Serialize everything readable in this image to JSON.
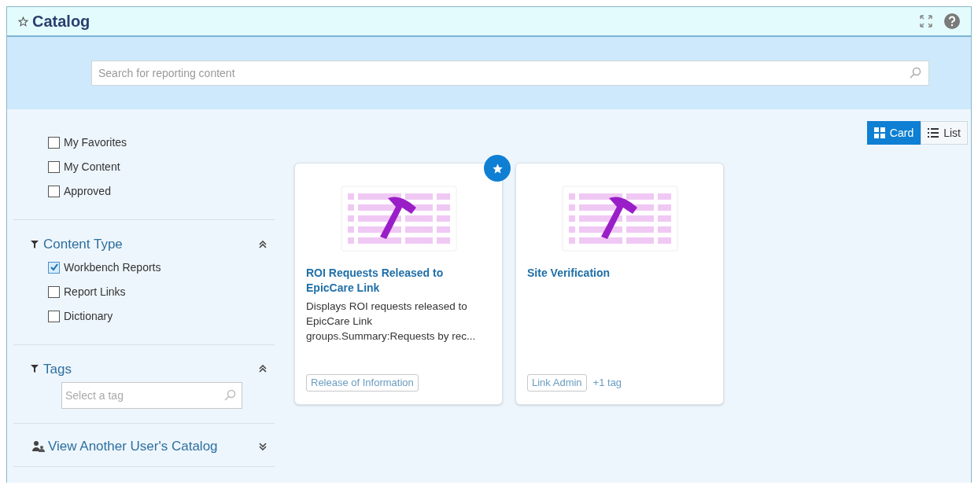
{
  "window": {
    "title": "Catalog"
  },
  "search": {
    "placeholder": "Search for reporting content"
  },
  "view_toggle": [
    {
      "label": "Card",
      "selected": true
    },
    {
      "label": "List",
      "selected": false
    }
  ],
  "quick_filters": [
    {
      "label": "My Favorites",
      "checked": false
    },
    {
      "label": "My Content",
      "checked": false
    },
    {
      "label": "Approved",
      "checked": false
    }
  ],
  "content_type": {
    "title": "Content Type",
    "expanded": true,
    "options": [
      {
        "label": "Workbench Reports",
        "checked": true
      },
      {
        "label": "Report Links",
        "checked": false
      },
      {
        "label": "Dictionary",
        "checked": false
      }
    ]
  },
  "tags": {
    "title": "Tags",
    "expanded": true,
    "placeholder": "Select a tag"
  },
  "other_catalog": {
    "title": "View Another User's Catalog",
    "expanded": false
  },
  "cards": [
    {
      "title": "ROI Requests Released to EpicCare Link",
      "description": "Displays ROI requests released to EpicCare Link groups.Summary:Requests by rec...",
      "favorite": true,
      "tags": [
        "Release of Information"
      ]
    },
    {
      "title": "Site Verification",
      "favorite": false,
      "tags": [
        "Link Admin"
      ],
      "more_tags": "+1 tag"
    }
  ]
}
